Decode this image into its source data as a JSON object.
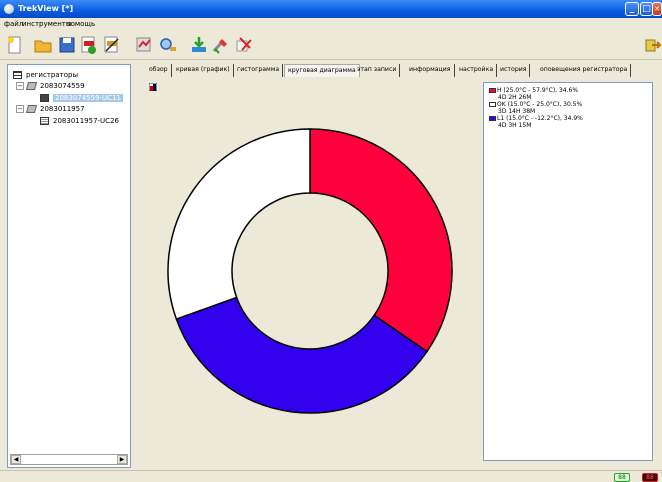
{
  "window": {
    "title": "TrekView [*]",
    "minimize": "_",
    "maximize": "□",
    "close": "✕"
  },
  "menu": [
    "файл",
    "инструменты",
    "помощь"
  ],
  "tree": {
    "root": "регистраторы",
    "groups": [
      {
        "id": "2083074559",
        "child": "2083074559-UC11",
        "selected": true
      },
      {
        "id": "2083011957",
        "child": "2083011957-UC26",
        "selected": false
      }
    ],
    "scroll_left": "◀",
    "scroll_right": "▶"
  },
  "tabs": [
    {
      "label": "обзор",
      "active": false
    },
    {
      "label": "кривая (график)",
      "active": false
    },
    {
      "label": "гистограмма",
      "active": false
    },
    {
      "label": "круговая диаграмма",
      "active": true
    },
    {
      "label": "этап записи",
      "active": false
    },
    {
      "label": "информация",
      "active": false
    },
    {
      "label": "настройка",
      "active": false
    },
    {
      "label": "история",
      "active": false
    },
    {
      "label": "оповещения регистратора",
      "active": false
    }
  ],
  "legend": [
    {
      "line1": "H (25.0°C - 57.9°C), 34.6%",
      "line2": "4D 2H 26M",
      "color": "#ff003c"
    },
    {
      "line1": "OK (15.0°C - 25.0°C), 30.5%",
      "line2": "3D 14H 38M",
      "color": "#ffffff"
    },
    {
      "line1": "L1 (15.0°C - -12.2°C), 34.9%",
      "line2": "4D 3H 15M",
      "color": "#3300ee"
    }
  ],
  "chart_data": {
    "type": "pie",
    "style": "donut",
    "slices": [
      {
        "label": "H",
        "value": 34.6,
        "color": "#ff003c"
      },
      {
        "label": "L1",
        "value": 34.9,
        "color": "#3300ee"
      },
      {
        "label": "OK",
        "value": 30.5,
        "color": "#ffffff"
      }
    ]
  },
  "status": {
    "ind1": "88",
    "ind2": "88"
  }
}
